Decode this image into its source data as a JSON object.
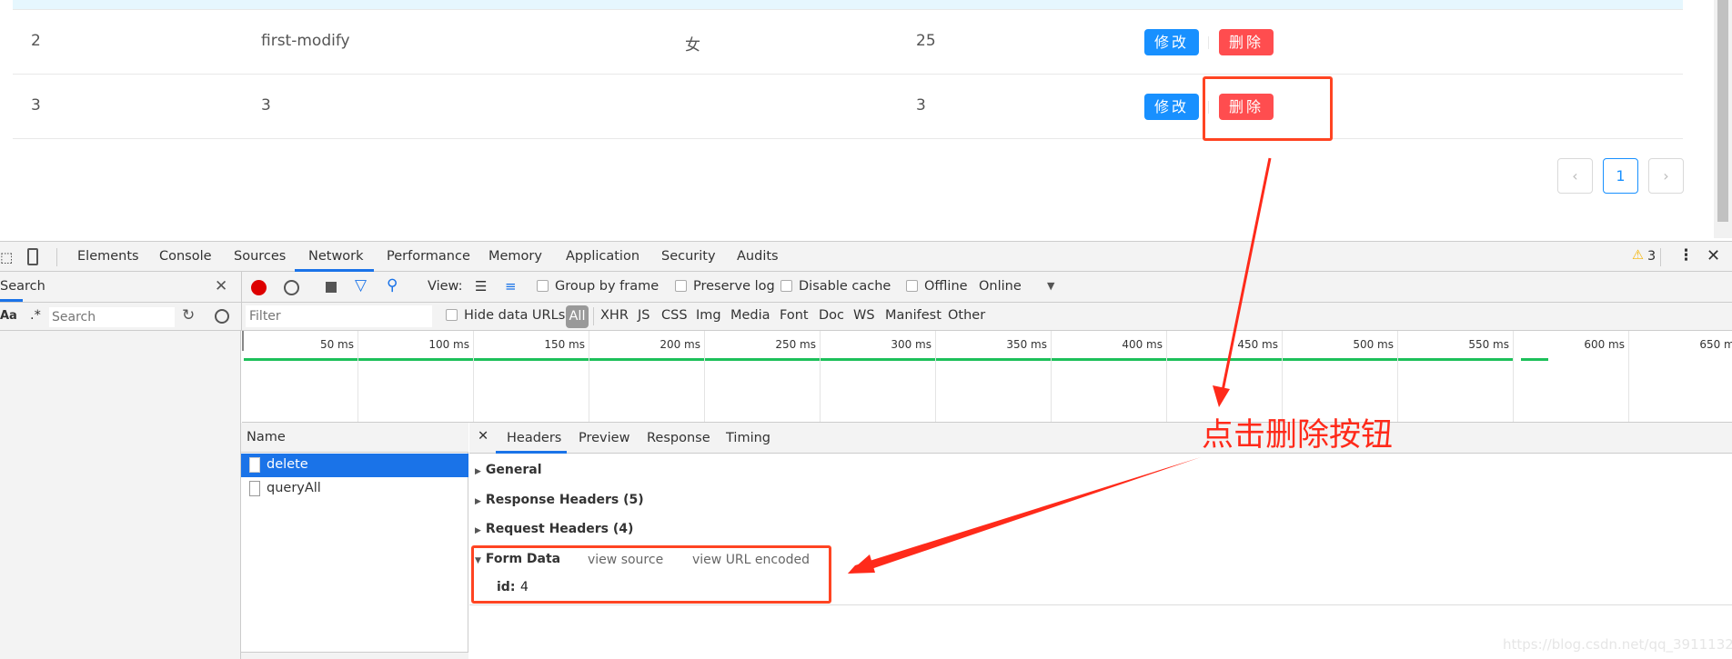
{
  "table": {
    "rows": [
      {
        "id": "2",
        "name": "first-modify",
        "gender": "女",
        "age": "25",
        "edit": "修改",
        "delete": "删除"
      },
      {
        "id": "3",
        "name": "3",
        "gender": "",
        "age": "3",
        "edit": "修改",
        "delete": "删除"
      }
    ]
  },
  "pagination": {
    "prev": "‹",
    "current": "1",
    "next": "›"
  },
  "devtools": {
    "tabs": [
      "Elements",
      "Console",
      "Sources",
      "Network",
      "Performance",
      "Memory",
      "Application",
      "Security",
      "Audits"
    ],
    "active_tab": "Network",
    "warnings": "3",
    "search_pane": {
      "title": "Search",
      "aa": "Aa",
      "regex": ".*",
      "placeholder": "Search"
    },
    "toolbar": {
      "view": "View:",
      "group_by_frame": "Group by frame",
      "preserve_log": "Preserve log",
      "disable_cache": "Disable cache",
      "offline": "Offline",
      "throttle": "Online"
    },
    "filter": {
      "placeholder": "Filter",
      "hide_data_urls": "Hide data URLs",
      "types": [
        "All",
        "XHR",
        "JS",
        "CSS",
        "Img",
        "Media",
        "Font",
        "Doc",
        "WS",
        "Manifest",
        "Other"
      ]
    },
    "timeline": {
      "ticks": [
        "50 ms",
        "100 ms",
        "150 ms",
        "200 ms",
        "250 ms",
        "300 ms",
        "350 ms",
        "400 ms",
        "450 ms",
        "500 ms",
        "550 ms",
        "600 ms",
        "650 ms"
      ]
    },
    "requests": {
      "header": "Name",
      "items": [
        "delete",
        "queryAll"
      ],
      "selected": "delete"
    },
    "details": {
      "tabs": [
        "Headers",
        "Preview",
        "Response",
        "Timing"
      ],
      "active": "Headers",
      "general": "General",
      "response_headers": "Response Headers (5)",
      "request_headers": "Request Headers (4)",
      "form_data": "Form Data",
      "view_source": "view source",
      "view_url_encoded": "view URL encoded",
      "form_key": "id:",
      "form_value": "4"
    }
  },
  "annotation": {
    "text": "点击删除按钮",
    "color": "#ff2a1a"
  },
  "watermark": "https://blog.csdn.net/qq_39111325"
}
